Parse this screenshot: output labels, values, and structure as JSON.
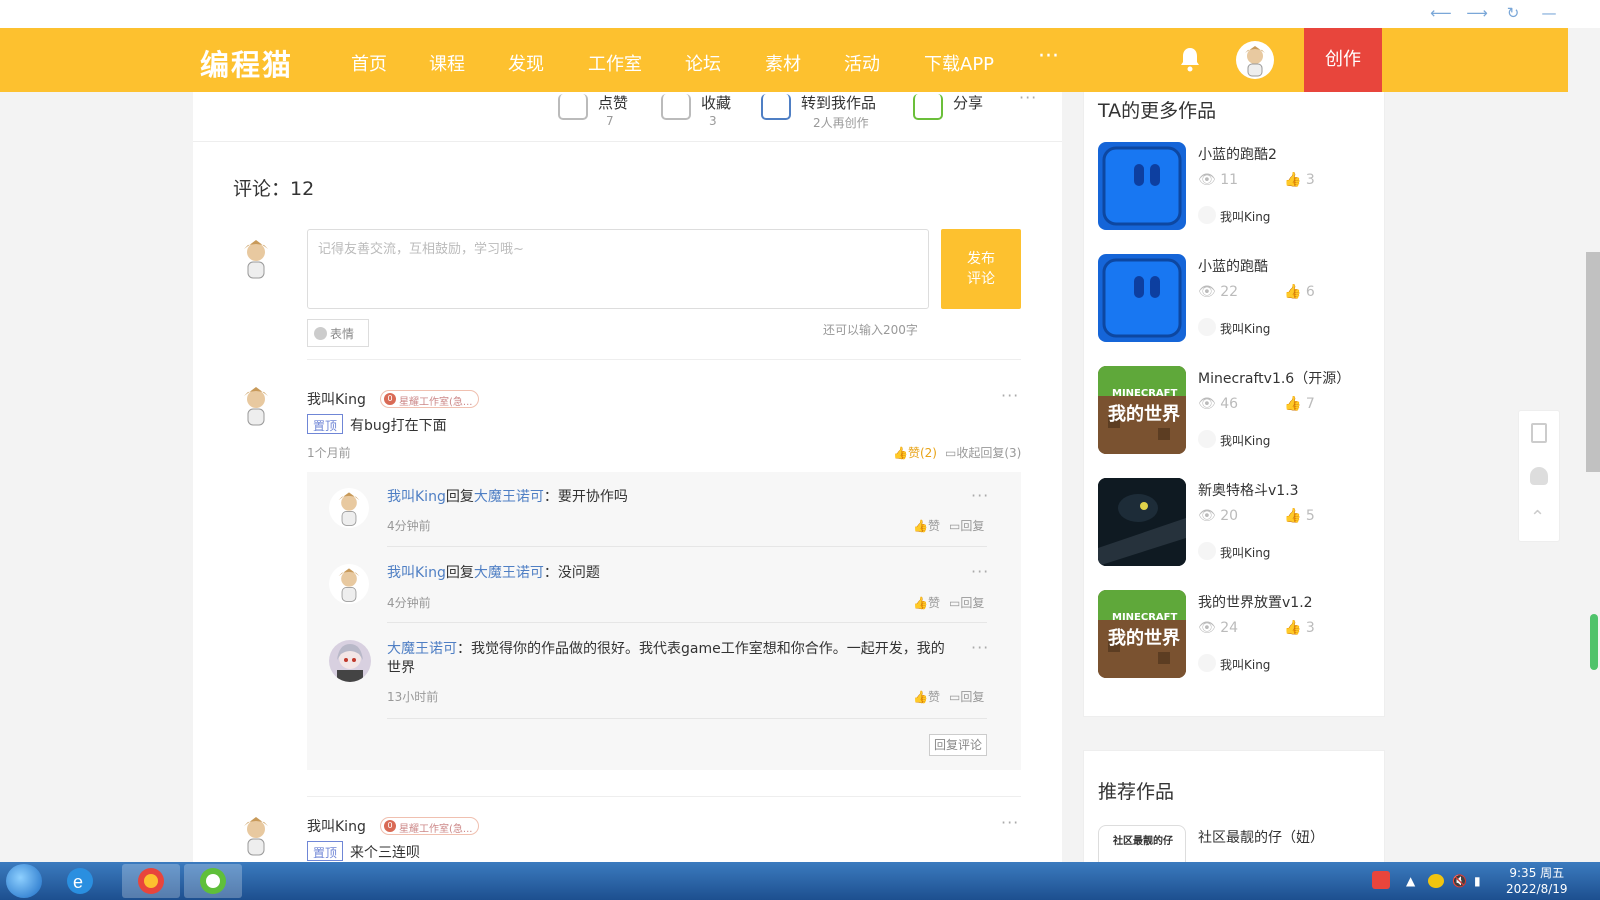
{
  "nav": {
    "logo": "编程猫",
    "items": [
      "首页",
      "课程",
      "发现",
      "工作室",
      "论坛",
      "素材",
      "活动",
      "下载APP"
    ],
    "more": "···",
    "create": "创作"
  },
  "actions": [
    {
      "label": "点赞",
      "count": "7"
    },
    {
      "label": "收藏",
      "count": "3"
    },
    {
      "label": "转到我作品",
      "count": "2人再创作"
    },
    {
      "label": "分享",
      "count": ""
    }
  ],
  "comments": {
    "title": "评论：12",
    "placeholder": "记得友善交流，互相鼓励，学习哦~",
    "publish": "发布评论",
    "emoji": "表情",
    "remaining": "还可以输入200字",
    "list": [
      {
        "user": "我叫King",
        "badge": "星耀工作室(急...",
        "badge_icon": "0",
        "top": "置顶",
        "text": "有bug打在下面",
        "time": "1个月前",
        "like": "赞(2)",
        "fold": "收起回复(3)",
        "replies": [
          {
            "user": "我叫King",
            "verb": "回复",
            "target": "大魔王诺可",
            "text": "：要开协作吗",
            "time": "4分钟前"
          },
          {
            "user": "我叫King",
            "verb": "回复",
            "target": "大魔王诺可",
            "text": "：没问题",
            "time": "4分钟前"
          },
          {
            "user": "大魔王诺可",
            "verb": "",
            "target": "",
            "text": "：我觉得你的作品做的很好。我代表game工作室想和你合作。一起开发，我的世界",
            "time": "13小时前"
          }
        ],
        "reply_like": "赞",
        "reply_reply": "回复",
        "reply_comment_btn": "回复评论"
      },
      {
        "user": "我叫King",
        "badge": "星耀工作室(急...",
        "badge_icon": "0",
        "top": "置顶",
        "text": "来个三连呗"
      }
    ]
  },
  "sidebar": {
    "more_title": "TA的更多作品",
    "works": [
      {
        "title": "小蓝的跑酷2",
        "views": "11",
        "likes": "3",
        "author": "我叫King",
        "thumb": "blue"
      },
      {
        "title": "小蓝的跑酷",
        "views": "22",
        "likes": "6",
        "author": "我叫King",
        "thumb": "blue"
      },
      {
        "title": "Minecraftv1.6（开源）",
        "views": "46",
        "likes": "7",
        "author": "我叫King",
        "thumb": "mc"
      },
      {
        "title": "新奥特格斗v1.3",
        "views": "20",
        "likes": "5",
        "author": "我叫King",
        "thumb": "dark"
      },
      {
        "title": "我的世界放置v1.2",
        "views": "24",
        "likes": "3",
        "author": "我叫King",
        "thumb": "mc"
      }
    ],
    "mc_logo_top": "MINECRAFT",
    "mc_logo_bottom": "我的世界",
    "recommend_title": "推荐作品",
    "recommend": [
      {
        "title": "社区最靓的仔（妞）",
        "thumb_text": "社区最靓的仔"
      }
    ]
  },
  "taskbar": {
    "time": "9:35 周五",
    "date": "2022/8/19"
  },
  "colors": {
    "brand": "#fdc12f",
    "create": "#e8453c",
    "link": "#4f7fc4",
    "top": "#6f86d6"
  }
}
